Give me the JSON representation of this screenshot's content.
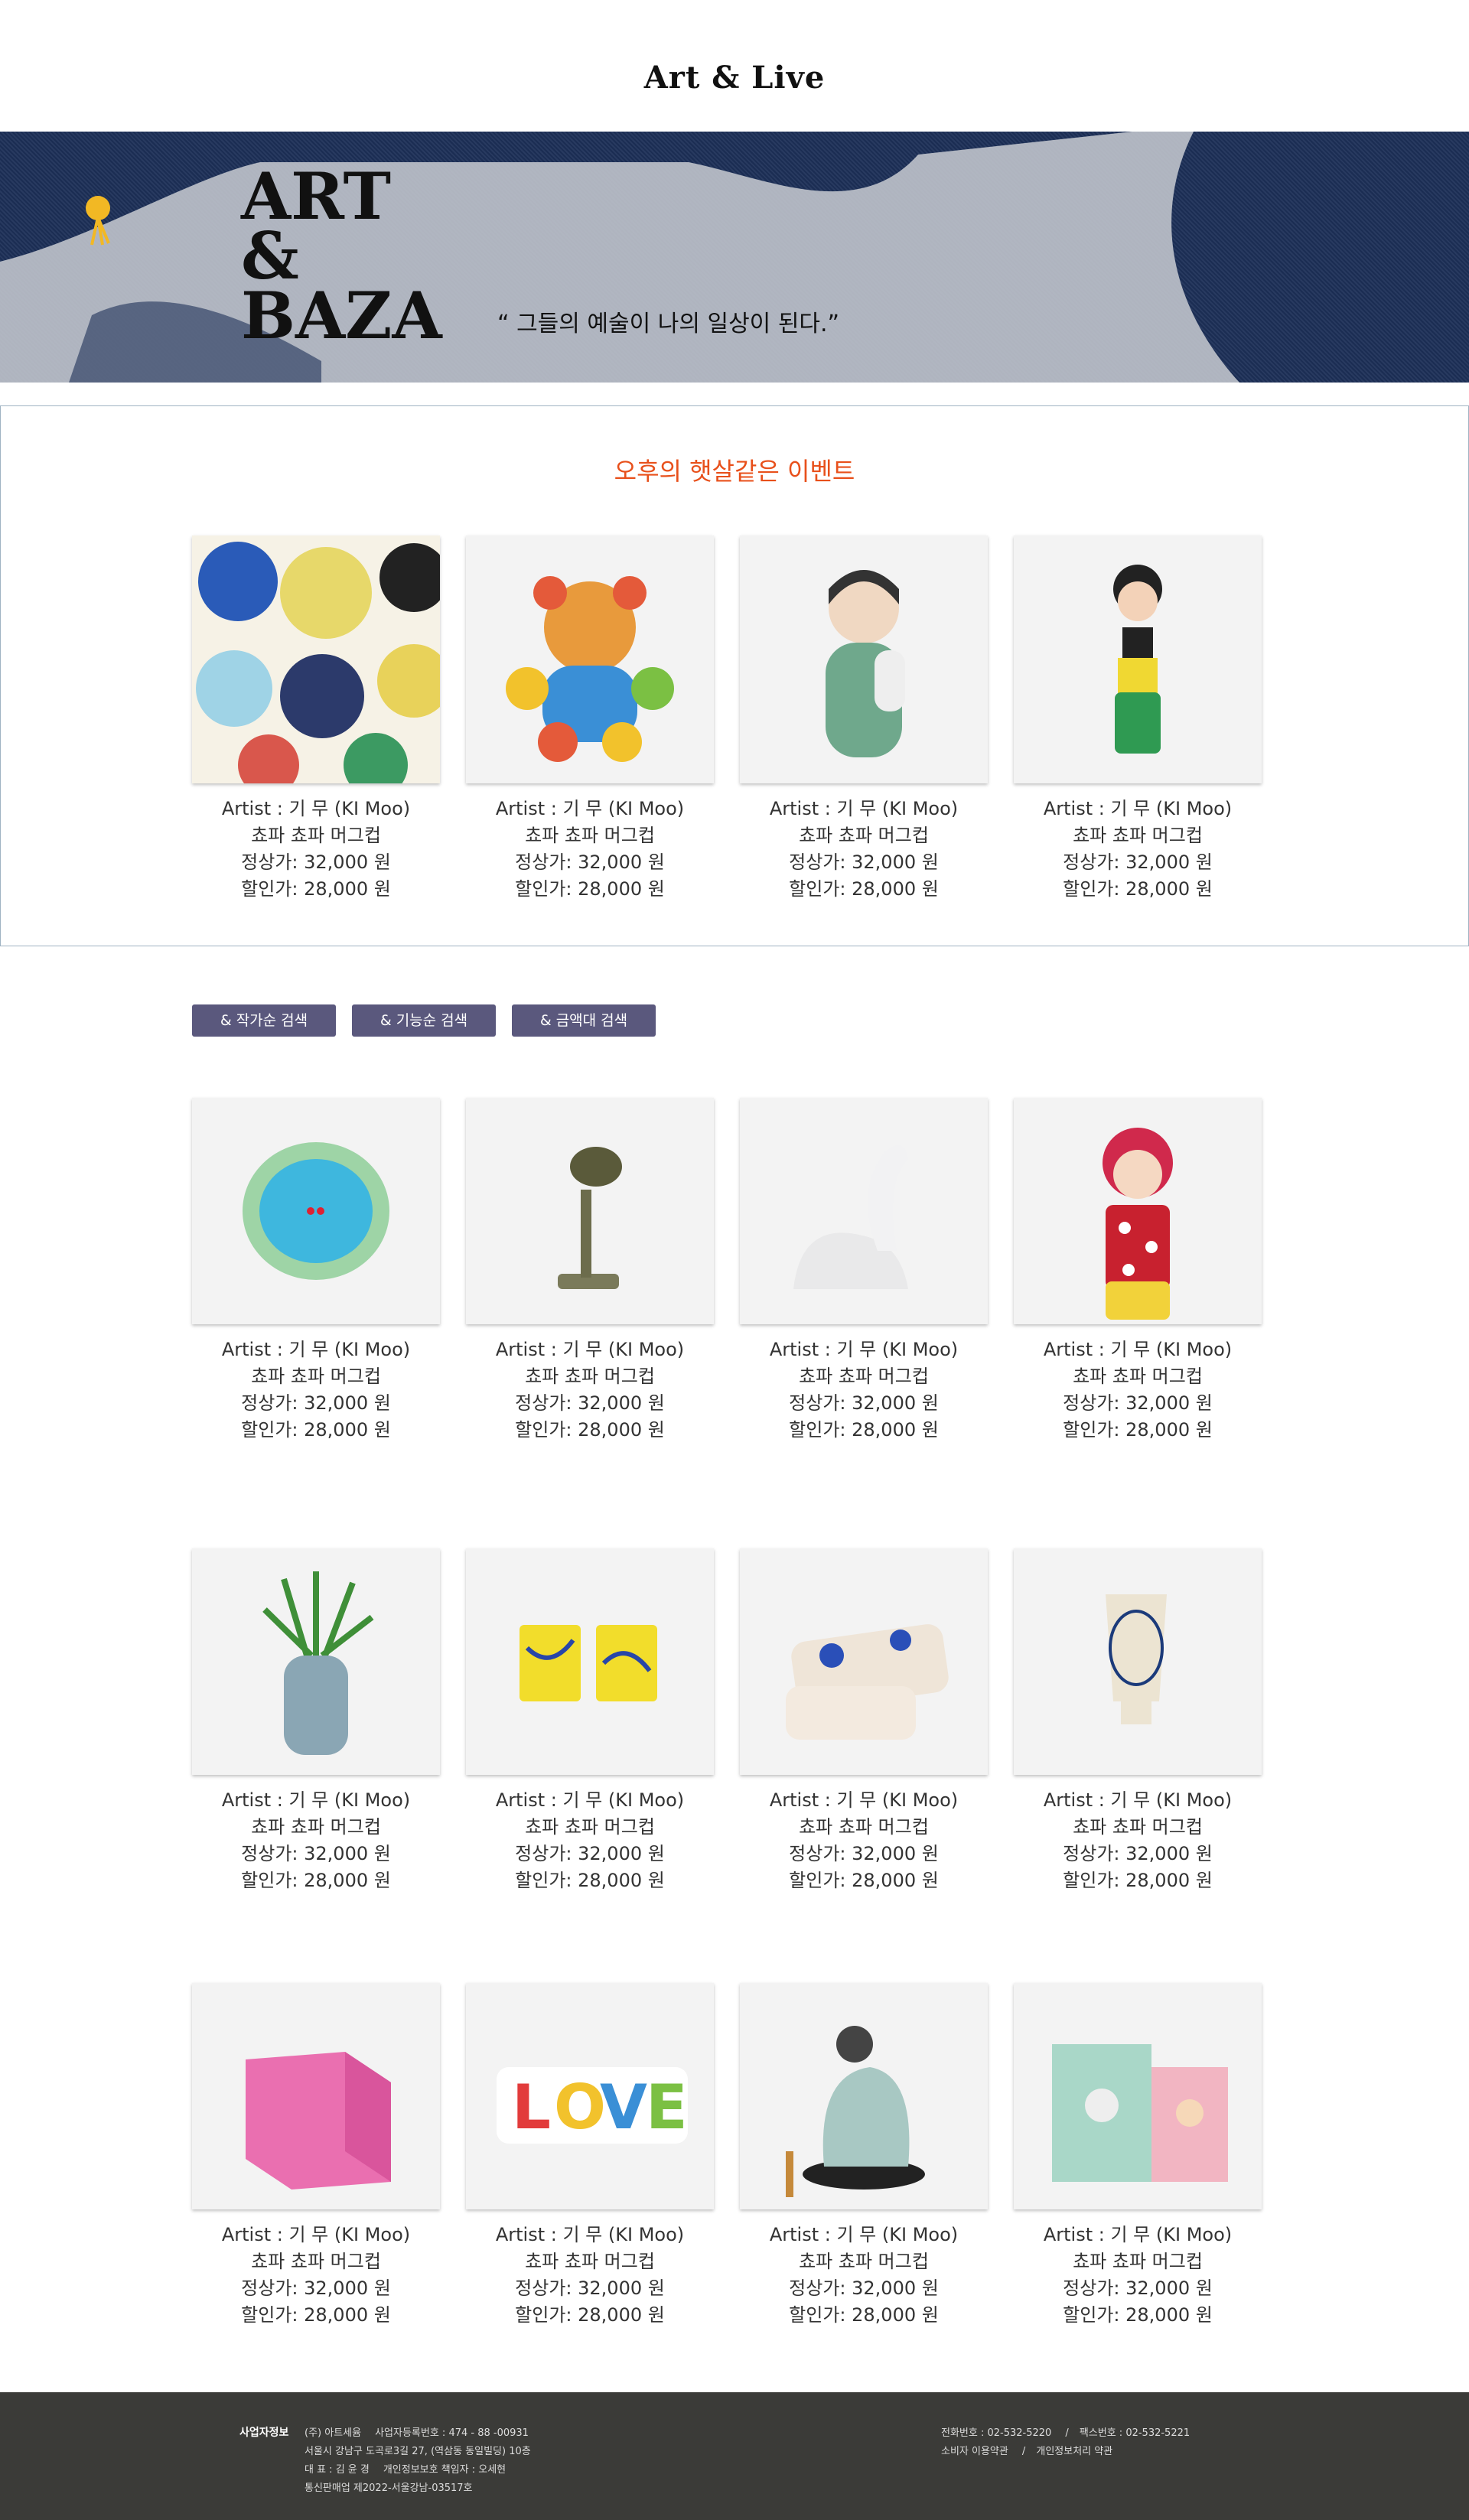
{
  "brand": "Art & Live",
  "hero": {
    "art_title_lines": [
      "ART",
      "&",
      "BAZA"
    ],
    "quote": "“ 그들의 예술이 나의 일상이 된다.”"
  },
  "event_title": "오후의 햇살같은 이벤트",
  "product_defaults": {
    "artist": "Artist :  기 무 (KI Moo)",
    "name": "쵸파 쵸파  머그컵",
    "regular": "정상가: 32,000 원",
    "sale": "할인가: 28,000 원"
  },
  "filters": [
    {
      "label": "& 작가순 검색"
    },
    {
      "label": "& 기능순 검색"
    },
    {
      "label": "& 금액대 검색"
    }
  ],
  "event_products": [
    {
      "icon": "plates-collage"
    },
    {
      "icon": "teddy-bear"
    },
    {
      "icon": "boy-figurine"
    },
    {
      "icon": "frida-doll"
    }
  ],
  "grid_rows": [
    [
      {
        "icon": "ceramic-plate"
      },
      {
        "icon": "desk-lamp"
      },
      {
        "icon": "swan-figure"
      },
      {
        "icon": "kokeshi-doll"
      }
    ],
    [
      {
        "icon": "face-planter"
      },
      {
        "icon": "yellow-cups"
      },
      {
        "icon": "pouches"
      },
      {
        "icon": "vase-cup"
      }
    ],
    [
      {
        "icon": "pink-box"
      },
      {
        "icon": "love-sign"
      },
      {
        "icon": "dodo-figurine"
      },
      {
        "icon": "shopping-bags"
      }
    ]
  ],
  "colors": {
    "accent": "#e8501b",
    "filter_bg": "#5a587d",
    "footer_bg": "#3b3b38",
    "hero_bg": "#1c2f57"
  },
  "footer": {
    "label": "사업자정보",
    "company": "(주) 아트세윰",
    "reg_no": "사업자등록번호 : 474 - 88 -00931",
    "address": "서울시 강남구 도곡로3길 27, (역삼동 동일빌딩) 10층",
    "ceo": "대 표 : 김 윤 경",
    "privacy_officer": "개인정보보호 책임자 : 오세현",
    "mail_order": "통신판매업 제2022-서울강남-03517호",
    "phone": "전화번호 : 02-532-5220",
    "fax": "팩스번호 : 02-532-5221",
    "terms": "소비자 이용약관",
    "privacy": "개인정보처리 약관"
  }
}
